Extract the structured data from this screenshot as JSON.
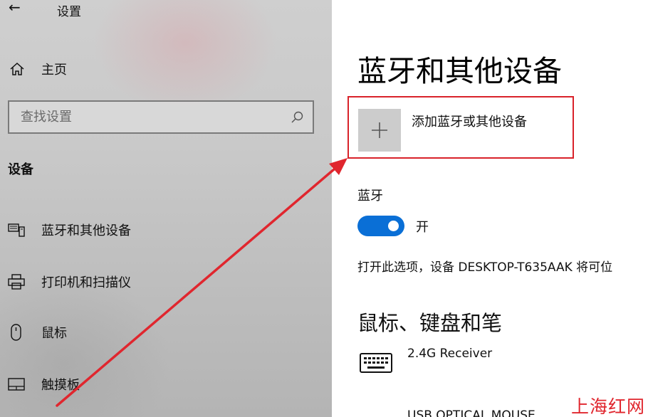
{
  "window": {
    "back_glyph": "←",
    "title": "设置"
  },
  "sidebar": {
    "home_label": "主页",
    "search_placeholder": "查找设置",
    "section_heading": "设备",
    "items": [
      {
        "label": "蓝牙和其他设备",
        "icon": "bluetooth-devices-icon"
      },
      {
        "label": "打印机和扫描仪",
        "icon": "printer-icon"
      },
      {
        "label": "鼠标",
        "icon": "mouse-icon"
      },
      {
        "label": "触摸板",
        "icon": "touchpad-icon"
      }
    ]
  },
  "main": {
    "title": "蓝牙和其他设备",
    "add_device_label": "添加蓝牙或其他设备",
    "bluetooth_heading": "蓝牙",
    "bluetooth_state_label": "开",
    "bluetooth_on": true,
    "discoverable_text": "打开此选项，设备 DESKTOP-T635AAK 将可位",
    "mouse_keyboard_heading": "鼠标、键盘和笔",
    "devices": [
      {
        "name": "2.4G Receiver",
        "icon": "keyboard-icon"
      },
      {
        "name": "USB OPTICAL MOUSE"
      }
    ]
  },
  "annotation": {
    "color": "#e0262e"
  },
  "watermark": {
    "text": "上海红网"
  },
  "colors": {
    "accent": "#0a6fd6",
    "highlight_box": "#d9222a",
    "sidebar_bg": "#c6c6c6"
  }
}
